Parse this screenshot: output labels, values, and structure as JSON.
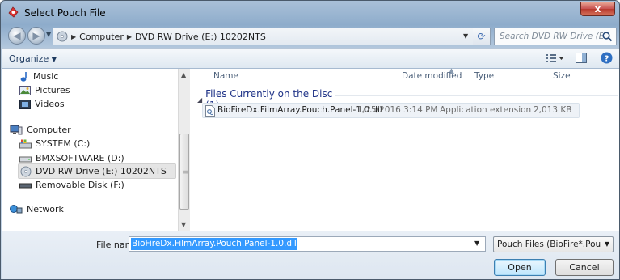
{
  "window": {
    "title": "Select Pouch File",
    "close_label": "x"
  },
  "address": {
    "segments": [
      "Computer",
      "DVD RW Drive (E:) 10202NTS"
    ],
    "search_placeholder": "Search DVD RW Drive (E:) NG..."
  },
  "toolbar": {
    "organize_label": "Organize"
  },
  "nav": {
    "items": [
      {
        "label": "Music",
        "icon": "music-icon"
      },
      {
        "label": "Pictures",
        "icon": "pictures-icon"
      },
      {
        "label": "Videos",
        "icon": "videos-icon"
      },
      {
        "label": "Computer",
        "icon": "computer-icon"
      },
      {
        "label": "SYSTEM (C:)",
        "icon": "system-drive-icon"
      },
      {
        "label": "BMXSOFTWARE (D:)",
        "icon": "drive-icon"
      },
      {
        "label": "DVD RW Drive (E:) 10202NTS",
        "icon": "dvd-drive-icon",
        "selected": true
      },
      {
        "label": "Removable Disk (F:)",
        "icon": "removable-disk-icon"
      },
      {
        "label": "Network",
        "icon": "network-icon"
      }
    ]
  },
  "columns": {
    "name": "Name",
    "date": "Date modified",
    "type": "Type",
    "size": "Size"
  },
  "group": {
    "label": "Files Currently on the Disc (1)"
  },
  "files": [
    {
      "name": "BioFireDx.FilmArray.Pouch.Panel-1.0.dll",
      "date": "1/25/2016 3:14 PM",
      "type": "Application extension",
      "size": "2,013 KB"
    }
  ],
  "bottom": {
    "filename_label": "File name:",
    "filename_value": "BioFireDx.FilmArray.Pouch.Panel-1.0.dll",
    "filter_value": "Pouch Files (BioFire*.Pouch.*.d",
    "open_label": "Open",
    "cancel_label": "Cancel"
  },
  "colors": {
    "selection": "#3399ff",
    "group_header": "#1e3287",
    "title_bar": "#8eaccb"
  }
}
